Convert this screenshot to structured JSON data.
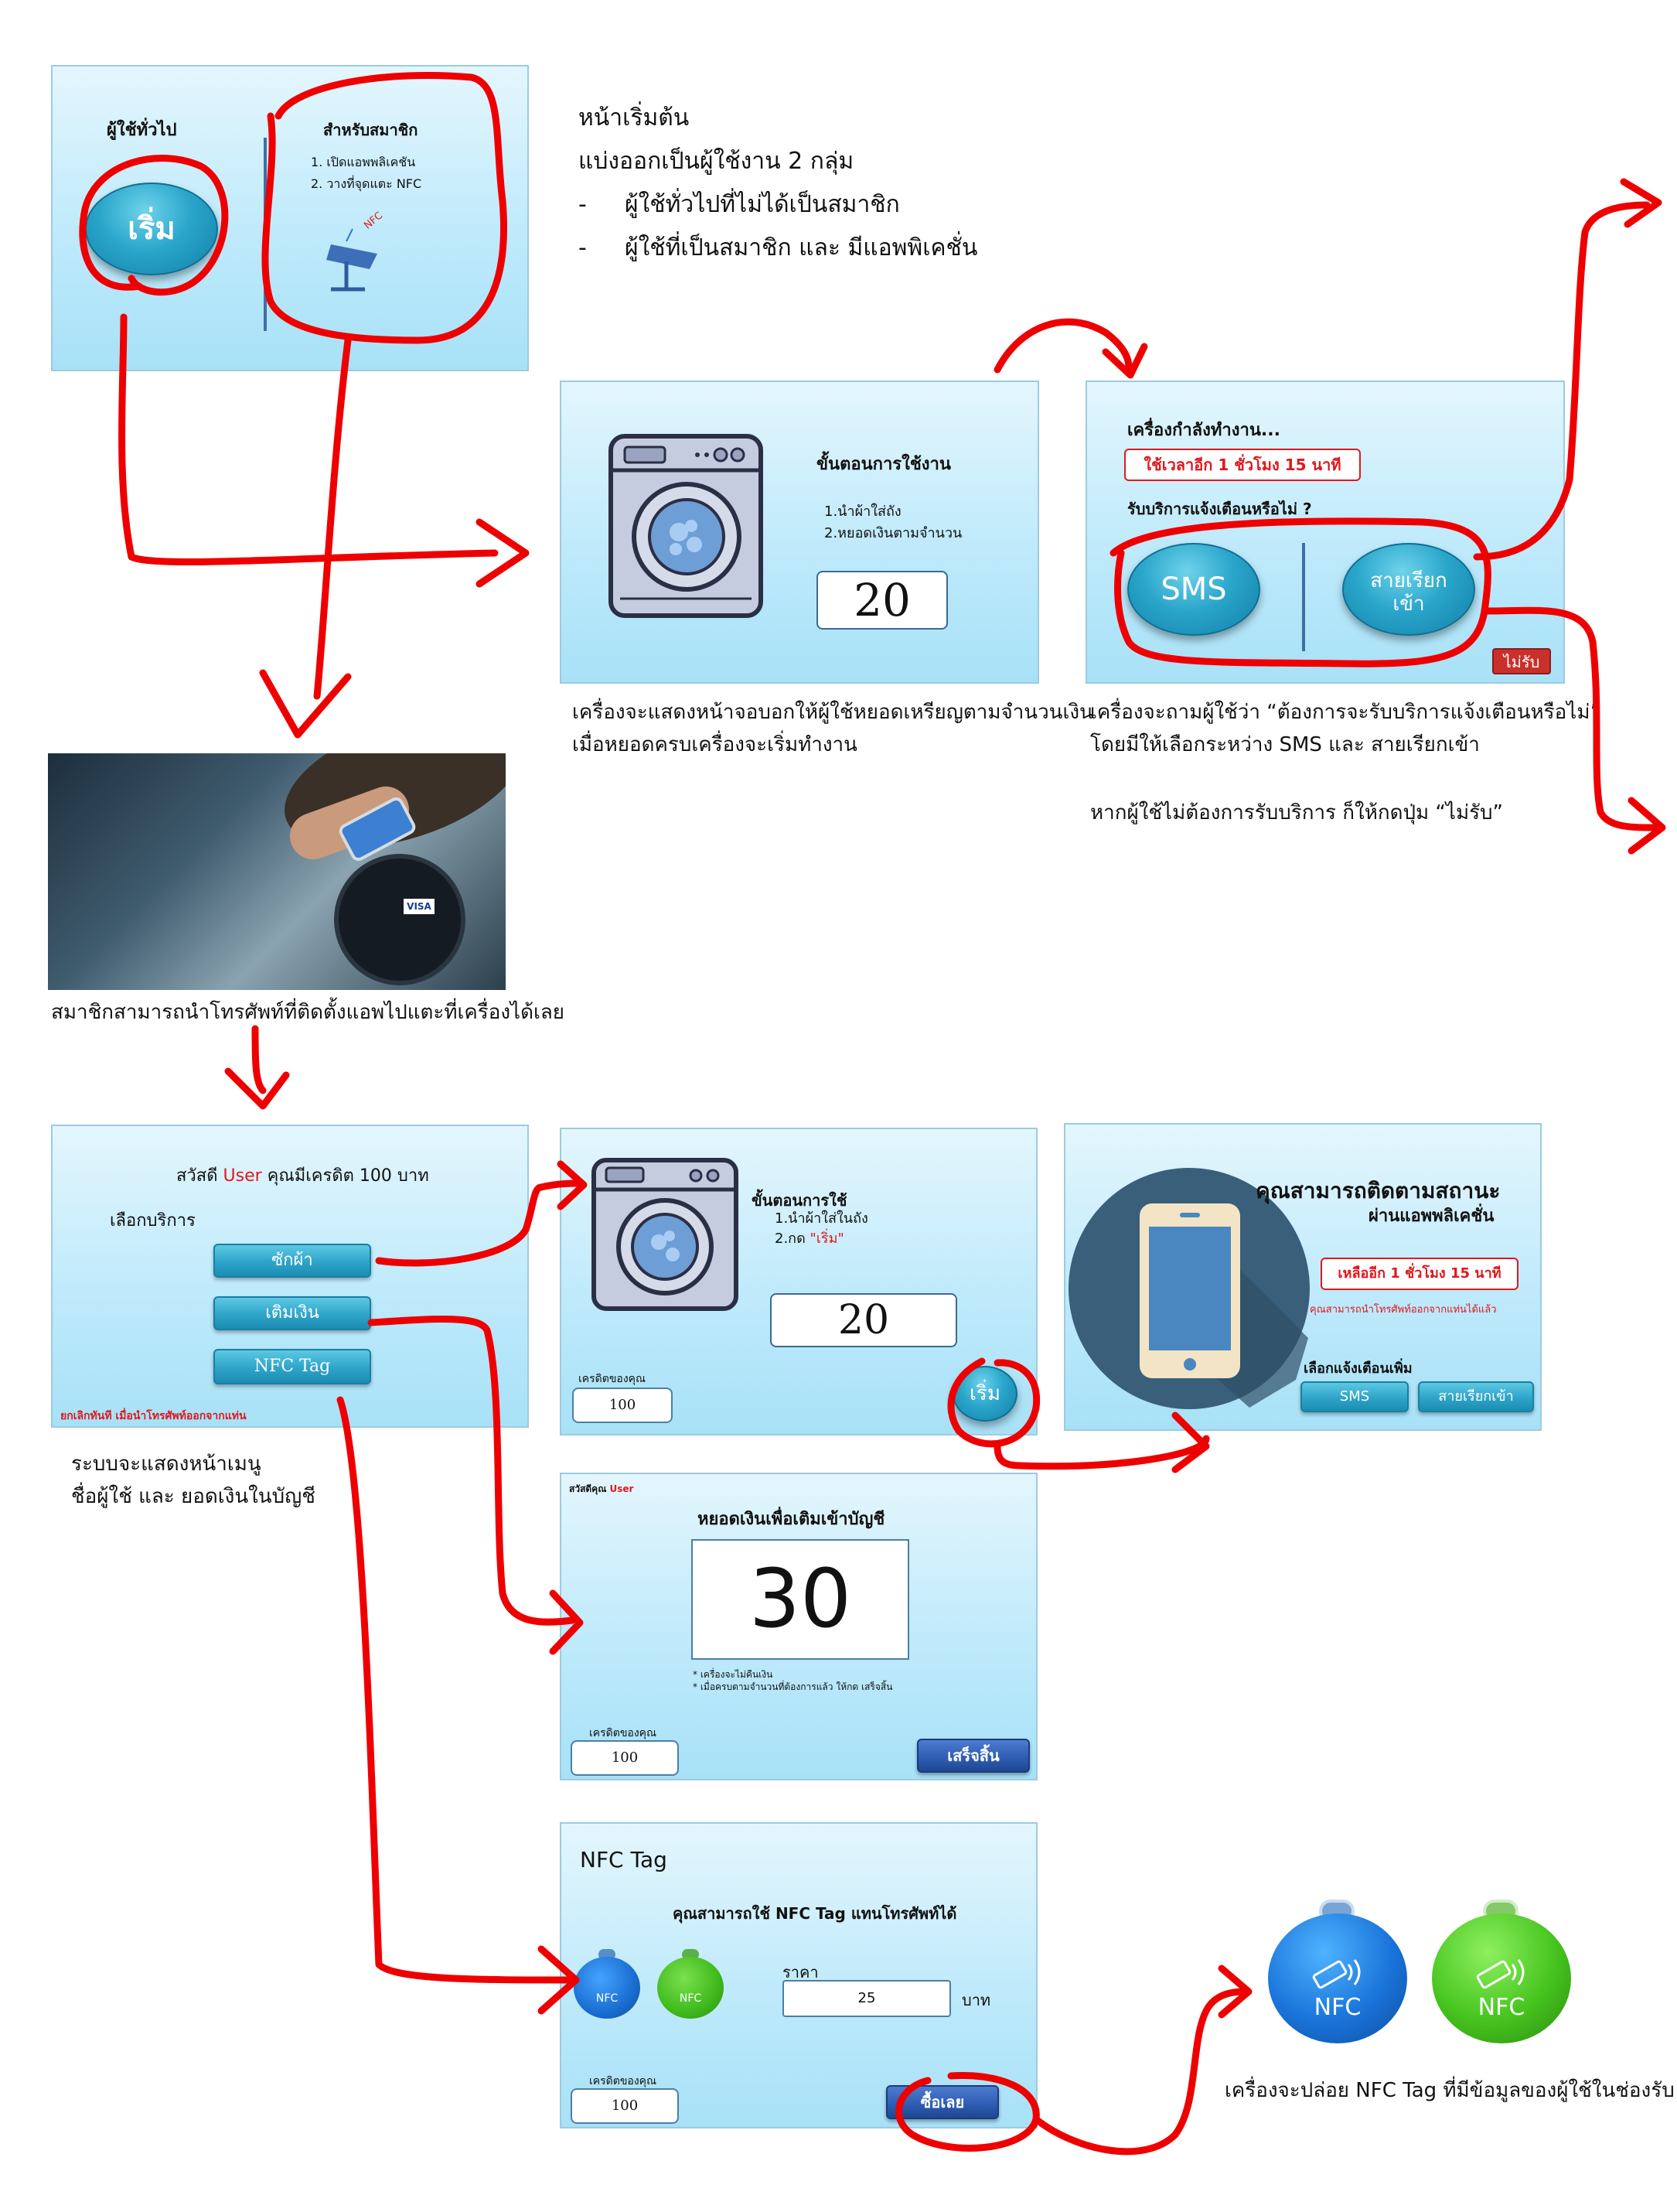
{
  "intro": {
    "title": "หน้าเริ่มต้น",
    "line1": "แบ่งออกเป็นผู้ใช้งาน 2 กลุ่ม",
    "bullet1": "ผู้ใช้ทั่วไปที่ไม่ได้เป็นสมาชิก",
    "bullet2": "ผู้ใช้ที่เป็นสมาชิก และ มีแอพพิเคชั่น",
    "dash": "-"
  },
  "screen_start": {
    "general_label": "ผู้ใช้ทั่วไป",
    "start_button": "เริ่ม",
    "member_label": "สำหรับสมาชิก",
    "step1": "1. เปิดแอพพลิเคชัน",
    "step2": "2. วางที่จุดแตะ NFC",
    "nfc_label": "NFC"
  },
  "screen_pay": {
    "heading": "ขั้นตอนการใช้งาน",
    "step1": "1.นำผ้าใส่ถัง",
    "step2": "2.หยอดเงินตามจำนวน",
    "amount": "20",
    "caption1": "เครื่องจะแสดงหน้าจอบอกให้ผู้ใช้หยอดเหรียญตามจำนวนเงิน",
    "caption2": "เมื่อหยอดครบเครื่องจะเริ่มทำงาน"
  },
  "screen_running": {
    "status": "เครื่องกำลังทำงาน...",
    "time_left": "ใช้เวลาอีก 1 ชั่วโมง 15 นาที",
    "question": "รับบริการแจ้งเตือนหรือไม่ ?",
    "sms_button": "SMS",
    "call_button_1": "สายเรียก",
    "call_button_2": "เข้า",
    "decline_button": "ไม่รับ",
    "caption1": "เครื่องจะถามผู้ใช้ว่า “ต้องการจะรับบริการแจ้งเตือนหรือไม่”",
    "caption2": "โดยมีให้เลือกระหว่าง SMS และ สายเรียกเข้า",
    "caption3": "หากผู้ใช้ไม่ต้องการรับบริการ ก็ให้กดปุ่ม “ไม่รับ”"
  },
  "photo": {
    "card_brand": "VISA",
    "caption": "สมาชิกสามารถนำโทรศัพท์ที่ติดตั้งแอพไปแตะที่เครื่องได้เลย"
  },
  "screen_menu": {
    "greeting_prefix": "สวัสดี",
    "user": "User",
    "greeting_suffix": "คุณมีเครดิต 100 บาท",
    "choose_service": "เลือกบริการ",
    "wash_button": "ซักผ้า",
    "topup_button": "เติมเงิน",
    "nfc_button": "NFC Tag",
    "cancel_note": "ยกเลิกทันที เมื่อนำโทรศัพท์ออกจากแท่น",
    "caption1": "ระบบจะแสดงหน้าเมนู",
    "caption2": "ชื่อผู้ใช้ และ ยอดเงินในบัญชี"
  },
  "screen_wash_member": {
    "heading": "ขั้นตอนการใช้",
    "step1": "1.นำผ้าใส่ในถัง",
    "step2_prefix": "2.กด",
    "step2_quote": "\"เริ่ม\"",
    "amount": "20",
    "credit_label": "เครดิตของคุณ",
    "credit_value": "100",
    "start_button": "เริ่ม"
  },
  "screen_track": {
    "title1": "คุณสามารถติดตามสถานะ",
    "title2": "ผ่านแอพพลิเคชั่น",
    "time_left": "เหลืออีก 1 ชั่วโมง 15 นาที",
    "remove_note": "คุณสามารถนำโทรศัพท์ออกจากแท่นได้แล้ว",
    "extra_label": "เลือกแจ้งเตือนเพิ่ม",
    "sms_button": "SMS",
    "call_button": "สายเรียกเข้า"
  },
  "screen_topup": {
    "greeting": "สวัสดีคุณ",
    "user": "User",
    "heading": "หยอดเงินเพื่อเติมเข้าบัญชี",
    "amount": "30",
    "note1": "* เครื่องจะไม่คืนเงิน",
    "note2": "* เมื่อครบตามจำนวนที่ต้องการแล้ว ให้กด เสร็จสิ้น",
    "credit_label": "เครดิตของคุณ",
    "credit_value": "100",
    "done_button": "เสร็จสิ้น"
  },
  "screen_nfc": {
    "title": "NFC Tag",
    "subtitle": "คุณสามารถใช้ NFC Tag แทนโทรศัพท์ได้",
    "tag_label": "NFC",
    "price_label": "ราคา",
    "price_value": "25",
    "currency": "บาท",
    "credit_label": "เครดิตของคุณ",
    "credit_value": "100",
    "buy_button": "ซื้อเลย"
  },
  "nfc_result": {
    "tag_label": "NFC",
    "caption": "เครื่องจะปล่อย NFC Tag ที่มีข้อมูลของผู้ใช้ในช่องรับ"
  },
  "colors": {
    "panel": "#bfeafb",
    "annotation": "#ee0000",
    "button": "#2ea4c8",
    "accent_red": "#e0181c"
  }
}
